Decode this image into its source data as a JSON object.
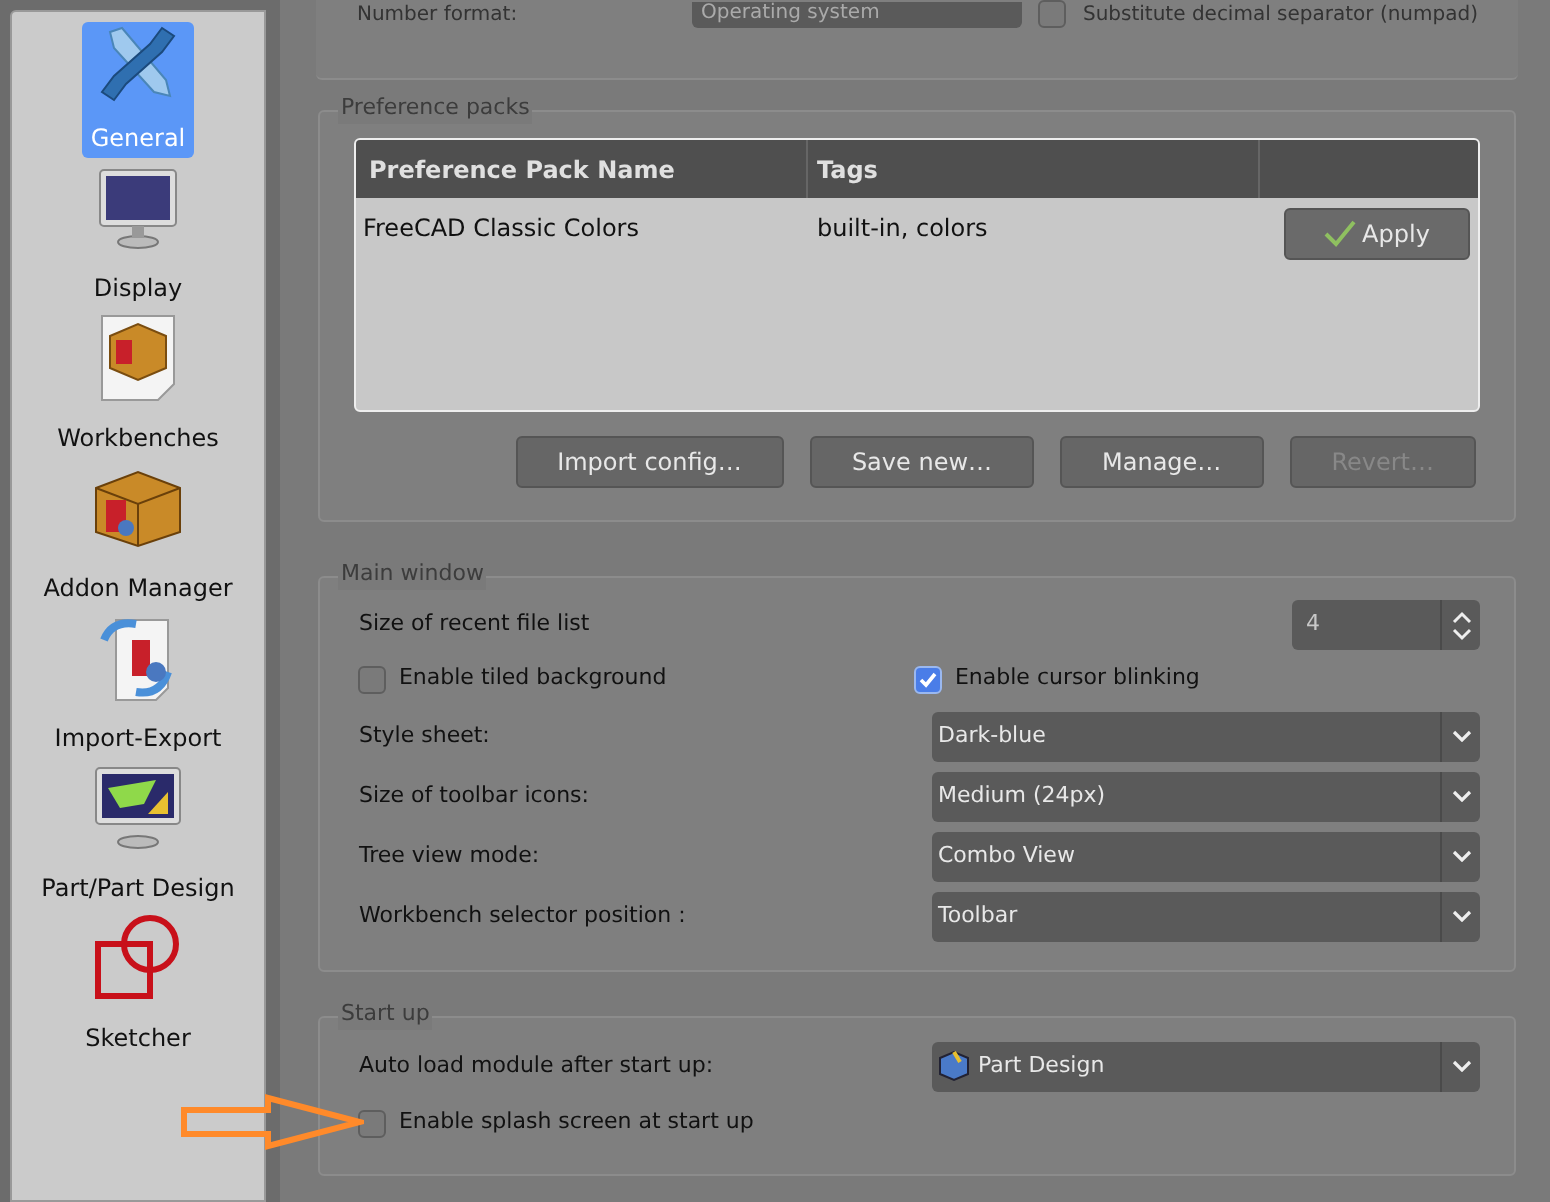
{
  "sidebar": {
    "items": [
      {
        "label": "General",
        "kind": "tools",
        "selected": true
      },
      {
        "label": "Display",
        "kind": "monitor",
        "selected": false
      },
      {
        "label": "Workbenches",
        "kind": "box-page",
        "selected": false
      },
      {
        "label": "Addon Manager",
        "kind": "box",
        "selected": false
      },
      {
        "label": "Import-Export",
        "kind": "page-arrows",
        "selected": false
      },
      {
        "label": "Part/Part Design",
        "kind": "monitor-part",
        "selected": false
      },
      {
        "label": "Sketcher",
        "kind": "sketch",
        "selected": false
      }
    ]
  },
  "top_row": {
    "label": "Number format:",
    "value": "Operating system",
    "checkbox": {
      "label": "Substitute decimal separator (numpad)",
      "checked": false
    }
  },
  "preference_packs": {
    "title": "Preference packs",
    "columns": [
      "Preference Pack Name",
      "Tags"
    ],
    "rows": [
      {
        "name": "FreeCAD Classic Colors",
        "tags": "built-in, colors",
        "action": "Apply"
      }
    ],
    "buttons": [
      {
        "label": "Import config…",
        "disabled": false
      },
      {
        "label": "Save new…",
        "disabled": false
      },
      {
        "label": "Manage…",
        "disabled": false
      },
      {
        "label": "Revert…",
        "disabled": true
      }
    ]
  },
  "main_window": {
    "title": "Main window",
    "rows": [
      {
        "kind": "spin",
        "label": "Size of recent file list",
        "value": "4"
      },
      {
        "kind": "checks",
        "items": [
          {
            "label": "Enable tiled background",
            "checked": false
          },
          {
            "label": "Enable cursor blinking",
            "checked": true
          }
        ]
      },
      {
        "kind": "combo",
        "label": "Style sheet:",
        "value": "Dark-blue"
      },
      {
        "kind": "combo",
        "label": "Size of toolbar icons:",
        "value": "Medium (24px)"
      },
      {
        "kind": "combo",
        "label": "Tree view mode:",
        "value": "Combo View"
      },
      {
        "kind": "combo",
        "label": "Workbench selector position :",
        "value": "Toolbar"
      }
    ]
  },
  "start_up": {
    "title": "Start up",
    "rows": [
      {
        "kind": "combo-icon",
        "label": "Auto load module after start up:",
        "value": "Part Design"
      },
      {
        "kind": "check",
        "label": "Enable splash screen at start up",
        "checked": false
      }
    ]
  }
}
